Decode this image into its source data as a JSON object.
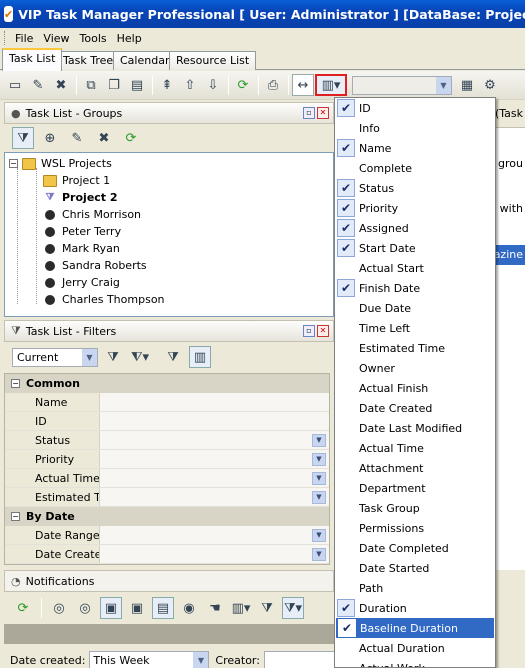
{
  "window": {
    "title": "VIP Task Manager Professional [ User: Administrator ] [DataBase: Projects]"
  },
  "menu": [
    "File",
    "View",
    "Tools",
    "Help"
  ],
  "tabs": [
    "Task List",
    "Task Tree",
    "Calendar",
    "Resource List"
  ],
  "groups_panel": {
    "title": "Task List - Groups",
    "tree": {
      "root": "WSL Projects",
      "projects": [
        "Project 1",
        "Project 2"
      ],
      "people": [
        "Chris Morrison",
        "Peter Terry",
        "Mark Ryan",
        "Sandra Roberts",
        "Jerry Craig",
        "Charles Thompson"
      ]
    }
  },
  "filters_panel": {
    "title": "Task List - Filters",
    "filter_value": "Current",
    "categories": [
      {
        "name": "Common",
        "fields": [
          "Name",
          "ID",
          "Status",
          "Priority",
          "Actual Time",
          "Estimated Tir"
        ]
      },
      {
        "name": "By Date",
        "fields": [
          "Date Range",
          "Date Createc"
        ]
      }
    ]
  },
  "right_partial": {
    "line1": "(Task",
    "line2": "o grou",
    "line3": "ts with",
    "line4": "azine"
  },
  "notifications": {
    "title": "Notifications",
    "date_created_label": "Date created:",
    "date_created_value": "This Week",
    "creator_label": "Creator:"
  },
  "column_menu": {
    "items": [
      {
        "label": "ID",
        "checked": true
      },
      {
        "label": "Info",
        "checked": false
      },
      {
        "label": "Name",
        "checked": true
      },
      {
        "label": "Complete",
        "checked": false
      },
      {
        "label": "Status",
        "checked": true
      },
      {
        "label": "Priority",
        "checked": true
      },
      {
        "label": "Assigned",
        "checked": true
      },
      {
        "label": "Start Date",
        "checked": true
      },
      {
        "label": "Actual Start",
        "checked": false
      },
      {
        "label": "Finish Date",
        "checked": true
      },
      {
        "label": "Due Date",
        "checked": false
      },
      {
        "label": "Time Left",
        "checked": false
      },
      {
        "label": "Estimated Time",
        "checked": false
      },
      {
        "label": "Owner",
        "checked": false
      },
      {
        "label": "Actual Finish",
        "checked": false
      },
      {
        "label": "Date Created",
        "checked": false
      },
      {
        "label": "Date Last Modified",
        "checked": false
      },
      {
        "label": "Actual Time",
        "checked": false
      },
      {
        "label": "Attachment",
        "checked": false
      },
      {
        "label": "Department",
        "checked": false
      },
      {
        "label": "Task Group",
        "checked": false
      },
      {
        "label": "Permissions",
        "checked": false
      },
      {
        "label": "Date Completed",
        "checked": false
      },
      {
        "label": "Date Started",
        "checked": false
      },
      {
        "label": "Path",
        "checked": false
      },
      {
        "label": "Duration",
        "checked": true
      },
      {
        "label": "Baseline Duration",
        "checked": true,
        "highlighted": true
      },
      {
        "label": "Actual Duration",
        "checked": false
      },
      {
        "label": "Actual Work",
        "checked": false
      }
    ]
  },
  "colors": {
    "title_bar": "#0a4fc8",
    "menu_highlight": "#316ac5",
    "active_tab_accent": "#ffc83c",
    "columns_button_outline": "#e02020"
  }
}
